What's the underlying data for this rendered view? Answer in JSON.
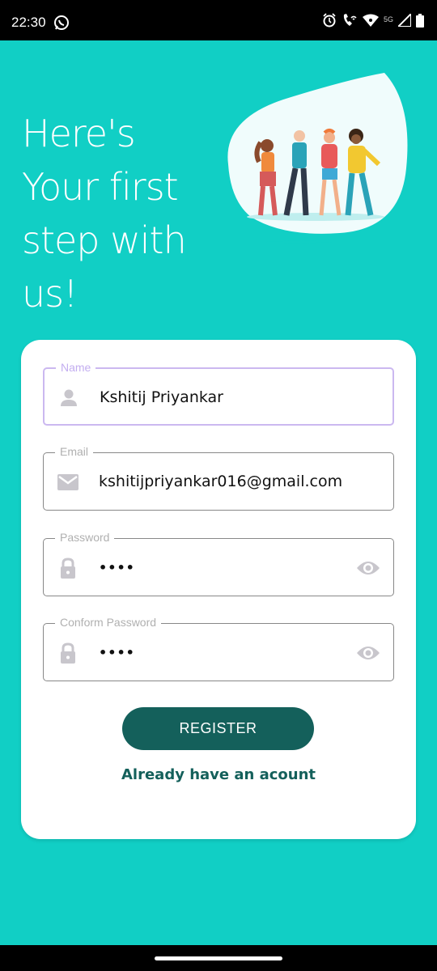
{
  "status_bar": {
    "time": "22:30",
    "network": "5G",
    "icons": [
      "whatsapp-icon",
      "alarm-icon",
      "wifi-call-icon",
      "wifi-icon",
      "signal-icon",
      "battery-icon"
    ]
  },
  "headline": {
    "line1": "Here's",
    "line2": "Your first",
    "line3": "step with",
    "line4": "us!"
  },
  "form": {
    "name": {
      "label": "Name",
      "value": "Kshitij Priyankar",
      "icon": "person-icon"
    },
    "email": {
      "label": "Email",
      "value": "kshitijpriyankar016@gmail.com",
      "icon": "mail-icon"
    },
    "password": {
      "label": "Password",
      "value": "••••",
      "icon": "lock-icon",
      "toggle_icon": "eye-icon"
    },
    "confirm_password": {
      "label": "Conform Password",
      "value": "••••",
      "icon": "lock-icon",
      "toggle_icon": "eye-icon"
    },
    "register_label": "REGISTER",
    "login_link": "Already have an acount"
  },
  "colors": {
    "background": "#11cfc5",
    "button": "#14605b",
    "active_border": "#cbb8f0",
    "icon_gray": "#c8c6cc"
  }
}
